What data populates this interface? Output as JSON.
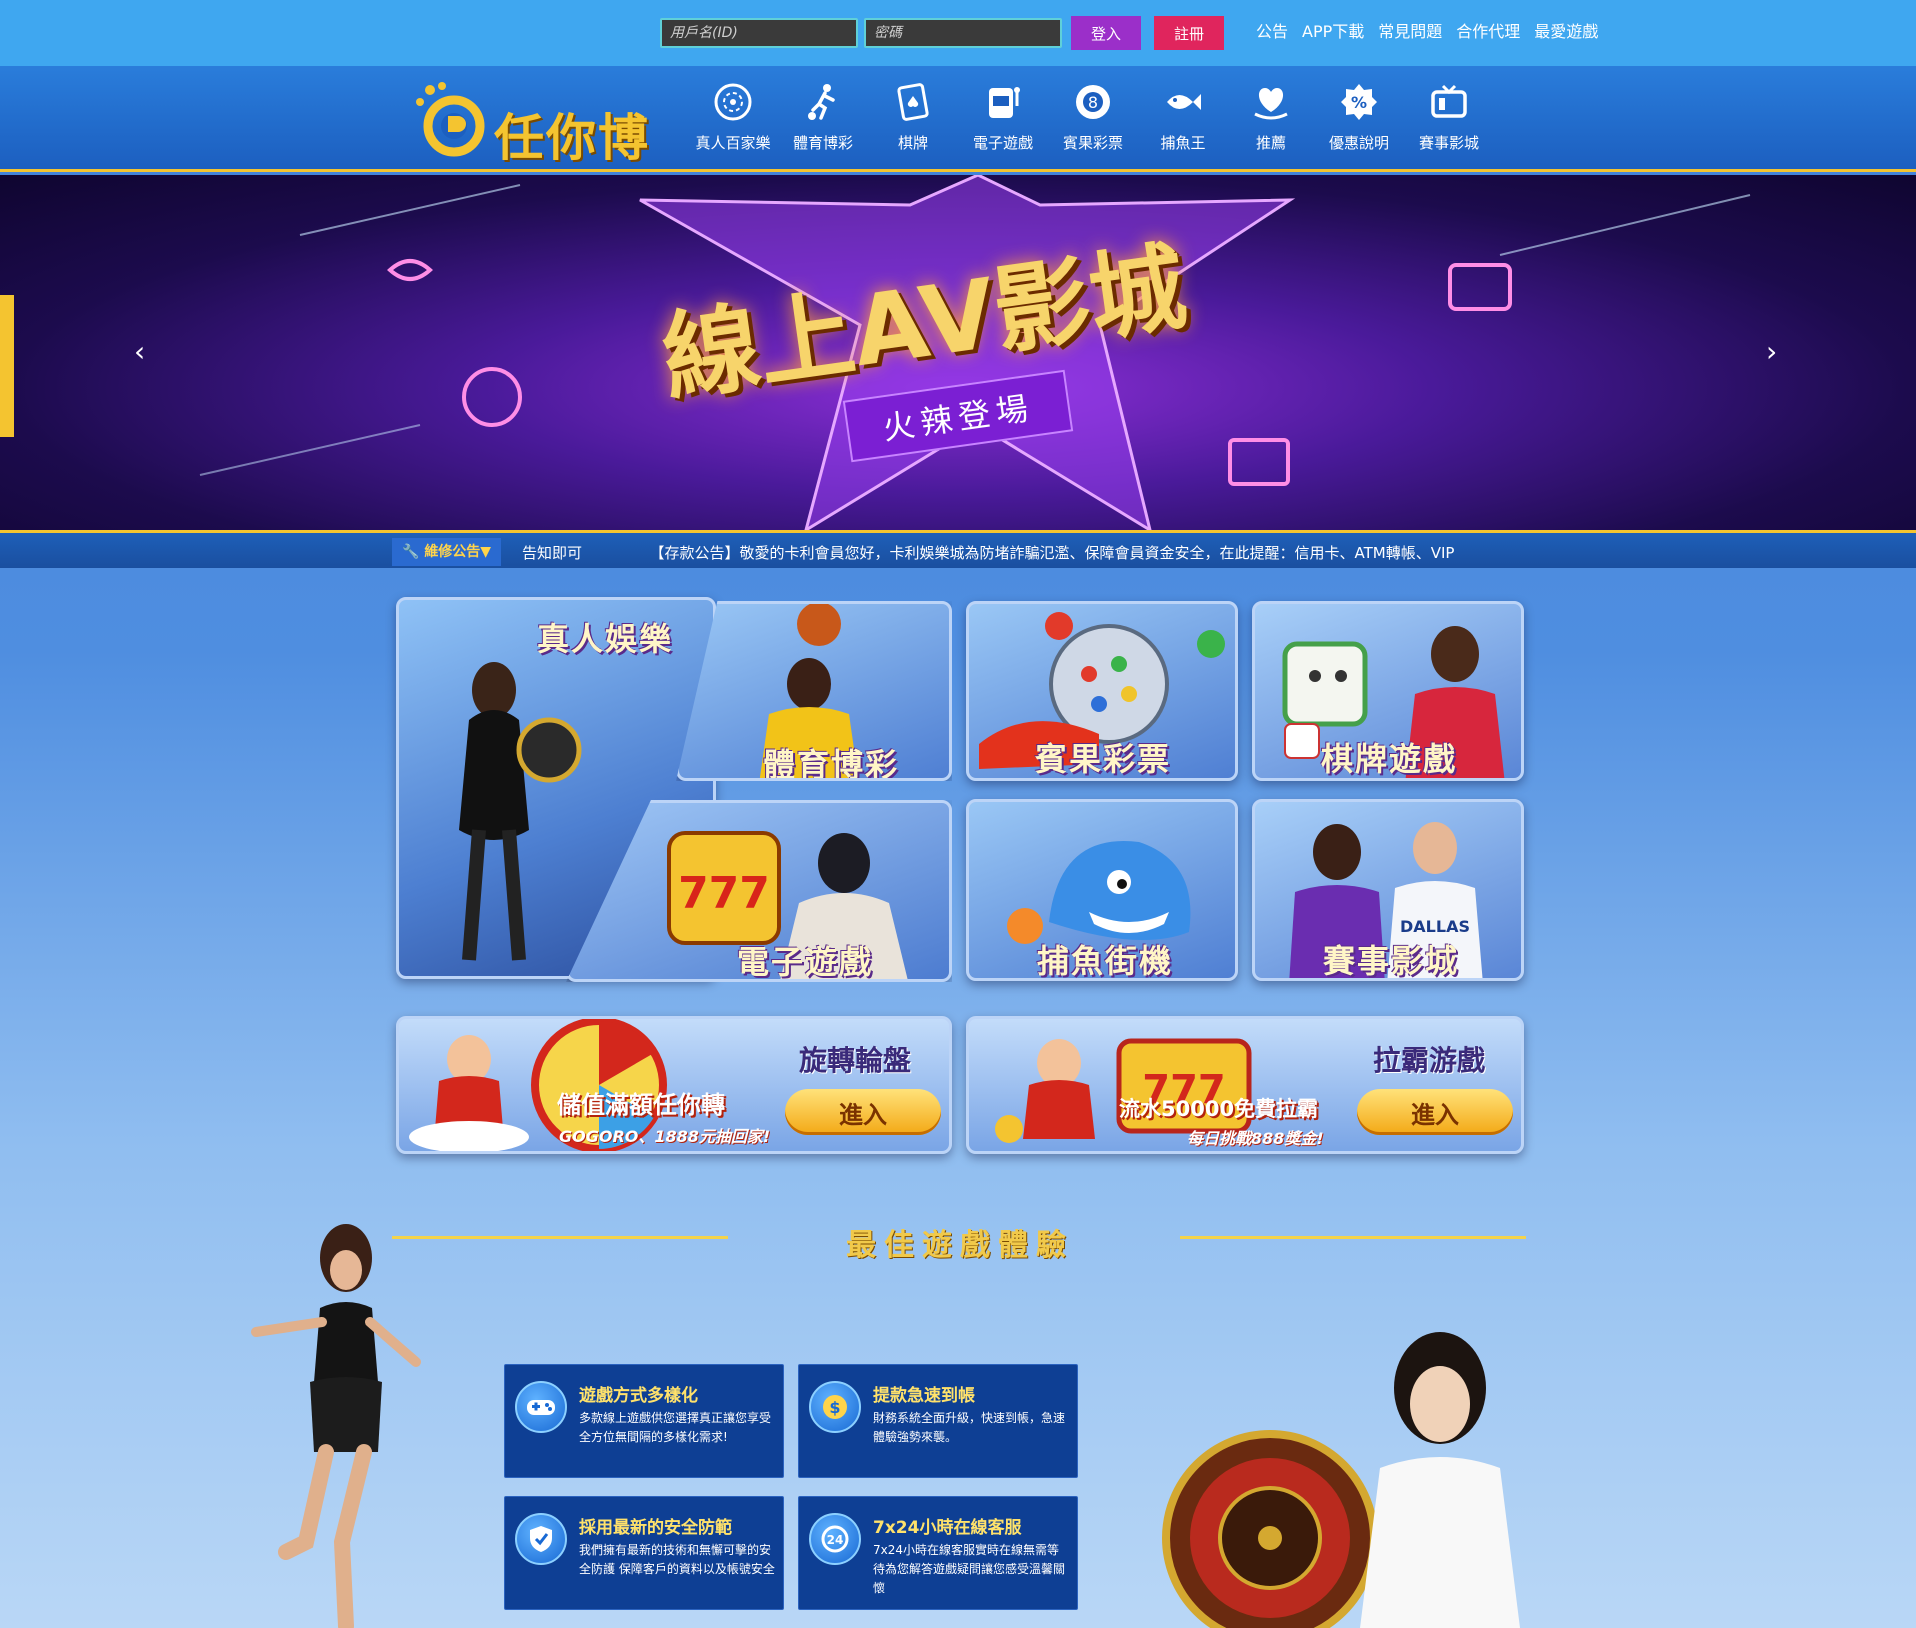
{
  "login": {
    "username_placeholder": "用戶名(ID)",
    "password_placeholder": "密碼",
    "login_label": "登入",
    "register_label": "註冊"
  },
  "top_links": [
    "公告",
    "APP下載",
    "常見問題",
    "合作代理",
    "最愛遊戲"
  ],
  "brand": {
    "logo_text": "任你博"
  },
  "nav": [
    {
      "label": "真人百家樂",
      "icon": "casino-chip-icon"
    },
    {
      "label": "體育博彩",
      "icon": "soccer-player-icon"
    },
    {
      "label": "棋牌",
      "icon": "playing-card-icon"
    },
    {
      "label": "電子遊戲",
      "icon": "slot-machine-icon"
    },
    {
      "label": "賓果彩票",
      "icon": "lottery-ball-icon"
    },
    {
      "label": "捕魚王",
      "icon": "fish-icon"
    },
    {
      "label": "推薦",
      "icon": "heart-hand-icon"
    },
    {
      "label": "優惠說明",
      "icon": "discount-badge-icon"
    },
    {
      "label": "賽事影城",
      "icon": "tv-icon"
    }
  ],
  "banner": {
    "title": "線上AV影城",
    "subtitle": "火辣登場",
    "prev_icon": "chevron-left-icon",
    "next_icon": "chevron-right-icon"
  },
  "notice": {
    "label": "維修公告▼",
    "text": "告知即可　　　　　【存款公告】敬愛的卡利會員您好，卡利娛樂城為防堵詐騙氾濫、保障會員資金安全，在此提醒：信用卡、ATM轉帳、VIP"
  },
  "games": {
    "live": "真人娛樂",
    "sports": "體育博彩",
    "lottery": "賓果彩票",
    "chess": "棋牌遊戲",
    "slots": "電子遊戲",
    "fishing": "捕魚街機",
    "cinema": "賽事影城"
  },
  "promos": [
    {
      "title": "旋轉輪盤",
      "text": "儲值滿額任你轉",
      "sub": "GOGORO、1888元抽回家!",
      "button": "進入"
    },
    {
      "title": "拉霸游戲",
      "text": "流水50000免費拉霸",
      "sub": "每日挑戰888獎金!",
      "button": "進入"
    }
  ],
  "section": {
    "title": "最佳遊戲體驗"
  },
  "features": [
    {
      "title": "遊戲方式多樣化",
      "text": "多款線上遊戲供您選擇真正讓您享受全方位無間隔的多樣化需求!",
      "icon": "gamepad-icon"
    },
    {
      "title": "提款急速到帳",
      "text": "財務系統全面升級，快速到帳，急速體驗強勢來襲。",
      "icon": "coin-icon"
    },
    {
      "title": "採用最新的安全防範",
      "text": "我們擁有最新的技術和無懈可擊的安全防護 保障客戶的資料以及帳號安全",
      "icon": "shield-icon"
    },
    {
      "title": "7x24小時在線客服",
      "text": "7x24小時在線客服實時在線無需等待為您解答遊戲疑問讓您感受溫馨關懷",
      "icon": "support-24-icon"
    }
  ]
}
